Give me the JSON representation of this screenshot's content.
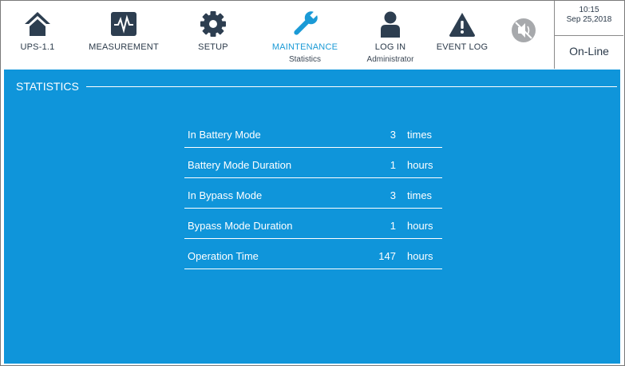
{
  "nav": {
    "ups": "UPS-1.1",
    "measurement": "MEASUREMENT",
    "setup": "SETUP",
    "maintenance": "MAINTENANCE",
    "maintenance_sub": "Statistics",
    "login": "LOG IN",
    "login_sub": "Administrator",
    "eventlog": "EVENT LOG"
  },
  "status": {
    "time": "10:15",
    "date": "Sep 25,2018",
    "mode": "On-Line"
  },
  "section": {
    "title": "STATISTICS"
  },
  "stats": [
    {
      "name": "In Battery Mode",
      "value": "3",
      "unit": "times"
    },
    {
      "name": "Battery Mode Duration",
      "value": "1",
      "unit": "hours"
    },
    {
      "name": "In Bypass Mode",
      "value": "3",
      "unit": "times"
    },
    {
      "name": "Bypass Mode Duration",
      "value": "1",
      "unit": "hours"
    },
    {
      "name": "Operation Time",
      "value": "147",
      "unit": "hours"
    }
  ],
  "colors": {
    "accent": "#0f95da",
    "icon": "#2d3e50",
    "active": "#1a9ad6",
    "mute": "#a7a9ac"
  }
}
